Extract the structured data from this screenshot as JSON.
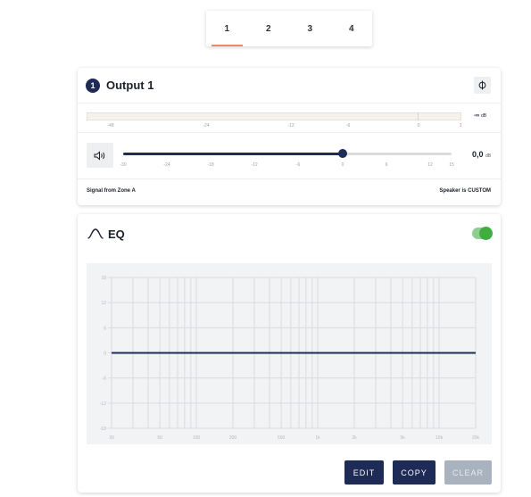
{
  "tabs": [
    "1",
    "2",
    "3",
    "4"
  ],
  "active_tab": "1",
  "output": {
    "number": "1",
    "title": "Output 1",
    "phase_icon": "phase-invert-icon",
    "meter": {
      "ticks": [
        "-48",
        "-24",
        "-12",
        "-6",
        "0",
        "3"
      ],
      "value": "-∞",
      "unit": "dB"
    },
    "gain": {
      "ticks": [
        "-30",
        "-24",
        "-18",
        "-12",
        "-6",
        "0",
        "6",
        "12",
        "15"
      ],
      "value": "0,0",
      "unit": "dB",
      "min": -30,
      "max": 15,
      "current": 0
    },
    "signal_text": "Signal from Zone A",
    "speaker_text": "Speaker is CUSTOM"
  },
  "eq": {
    "title": "EQ",
    "enabled": true,
    "y_labels": [
      "18",
      "12",
      "6",
      "0",
      "-6",
      "-12",
      "-18"
    ],
    "x_labels": [
      "20",
      "50",
      "100",
      "200",
      "500",
      "1k",
      "2k",
      "5k",
      "10k",
      "20k"
    ],
    "buttons": {
      "edit": "EDIT",
      "copy": "COPY",
      "clear": "CLEAR"
    },
    "colors": {
      "curve": "#1d2b56",
      "grid": "#d9dbdf"
    }
  }
}
